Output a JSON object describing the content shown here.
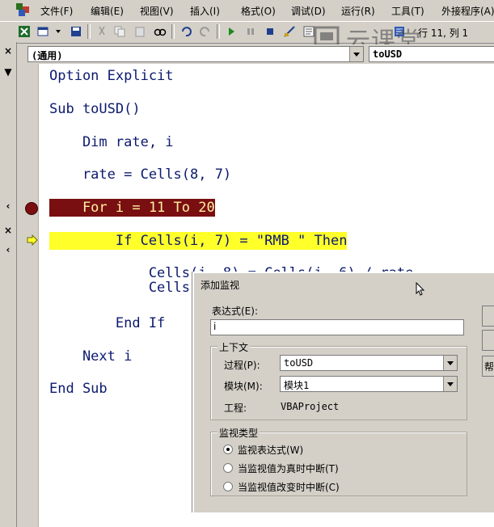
{
  "menubar": {
    "items": [
      "文件(F)",
      "编辑(E)",
      "视图(V)",
      "插入(I)",
      "格式(O)",
      "调试(D)",
      "运行(R)",
      "工具(T)",
      "外接程序(A)"
    ]
  },
  "toolbar": {
    "position_text": "行 11, 列 1",
    "icons": [
      "excel-icon",
      "insert-userform-icon",
      "save-icon",
      "cut-icon",
      "copy-icon",
      "paste-icon",
      "find-icon",
      "undo-icon",
      "redo-icon",
      "run-icon",
      "break-icon",
      "reset-icon",
      "design-mode-icon",
      "project-explorer-icon",
      "properties-icon"
    ]
  },
  "watermark": {
    "text": "云课堂"
  },
  "combos": {
    "object": "(通用)",
    "procedure": "toUSD"
  },
  "leftstrip": {
    "marks": [
      "×",
      "▼",
      "‹",
      "×",
      "‹"
    ]
  },
  "code": {
    "lines": [
      "Option Explicit",
      "Sub toUSD()",
      "    Dim rate, i",
      "    rate = Cells(8, 7)",
      "    For i = 11 To 20",
      "        If Cells(i, 7) = \"RMB \" Then",
      "            Cells(i, 8) = Cells(i, 6) / rate",
      "            Cells",
      "        End If",
      "    Next i",
      "End Sub"
    ],
    "breakpoint_line_index": 4,
    "current_line_index": 5
  },
  "dialog": {
    "title": "添加监视",
    "expression_label": "表达式(E):",
    "expression_value": "i",
    "context_group": "上下文",
    "procedure_label": "过程(P):",
    "procedure_value": "toUSD",
    "module_label": "模块(M):",
    "module_value": "模块1",
    "project_label": "工程:",
    "project_value": "VBAProject",
    "watch_type_group": "监视类型",
    "options": [
      {
        "label": "监视表达式(W)",
        "selected": true
      },
      {
        "label": "当监视值为真时中断(T)",
        "selected": false
      },
      {
        "label": "当监视值改变时中断(C)",
        "selected": false
      }
    ],
    "side_button_peek": "帮"
  },
  "colors": {
    "breakpoint_bg": "#7a0f12",
    "current_line_bg": "#ffff2a",
    "code_text": "#0c1a6e"
  }
}
